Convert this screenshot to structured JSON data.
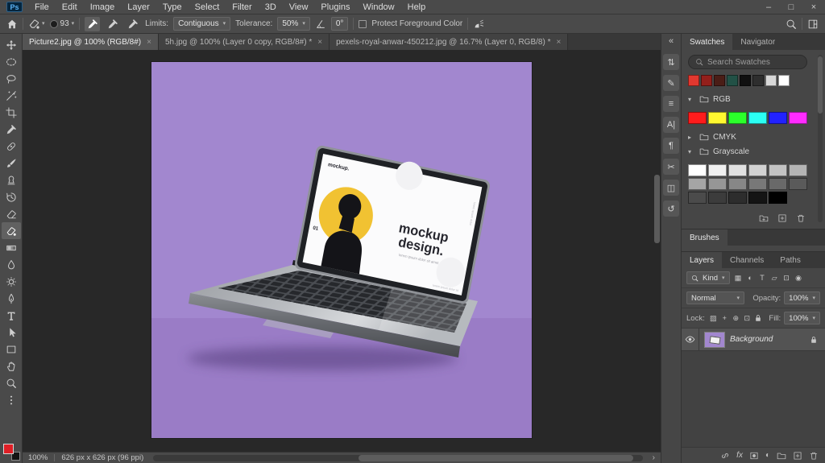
{
  "window": {
    "controls": {
      "minimize": "–",
      "maximize": "□",
      "close": "×"
    }
  },
  "ui": {
    "close_glyph": "×",
    "caret": "▾",
    "chevron_expanded": "▾",
    "chevron_collapsed": "▸",
    "status_chevron": "›",
    "collapse_glyph": "«"
  },
  "menu_bar": {
    "logo": "Ps",
    "items": [
      "File",
      "Edit",
      "Image",
      "Layer",
      "Type",
      "Select",
      "Filter",
      "3D",
      "View",
      "Plugins",
      "Window",
      "Help"
    ]
  },
  "options_bar": {
    "brush_size": "93",
    "limits_label": "Limits:",
    "limits_value": "Contiguous",
    "tolerance_label": "Tolerance:",
    "tolerance_value": "50%",
    "angle_value": "0°",
    "protect_label": "Protect Foreground Color"
  },
  "document_tabs": [
    {
      "label": "Picture2.jpg @ 100% (RGB/8#)",
      "active": true
    },
    {
      "label": "5h.jpg @ 100% (Layer 0 copy, RGB/8#) *",
      "active": false
    },
    {
      "label": "pexels-royal-anwar-450212.jpg @ 16.7% (Layer 0, RGB/8) *",
      "active": false
    }
  ],
  "toolbar": {
    "foreground_color": "#e01f26",
    "background_color": "#141414",
    "tools": [
      {
        "name": "move"
      },
      {
        "name": "marquee"
      },
      {
        "name": "lasso"
      },
      {
        "name": "quick-selection"
      },
      {
        "name": "crop"
      },
      {
        "name": "eyedropper"
      },
      {
        "name": "healing-brush"
      },
      {
        "name": "brush"
      },
      {
        "name": "clone-stamp"
      },
      {
        "name": "history-brush"
      },
      {
        "name": "eraser"
      },
      {
        "name": "background-eraser",
        "selected": true
      },
      {
        "name": "gradient"
      },
      {
        "name": "blur"
      },
      {
        "name": "dodge"
      },
      {
        "name": "pen"
      },
      {
        "name": "type"
      },
      {
        "name": "path-selection"
      },
      {
        "name": "rectangle"
      },
      {
        "name": "hand"
      },
      {
        "name": "zoom"
      },
      {
        "name": "edit-toolbar"
      }
    ]
  },
  "canvas": {
    "artwork": {
      "background_top": "#a287cf",
      "background_floor": "#9a7cc6",
      "accent_circle_color": "#f1c232",
      "laptop_screen": {
        "brand": "mockup.",
        "title_line1": "mockup",
        "title_line2": "design.",
        "subtitle": "lorem ipsum dolor sit amet",
        "index": "01",
        "side_text": "lorem ipsum dolor",
        "footer_text": "lorem ipsum dolor sit"
      }
    }
  },
  "status_bar": {
    "zoom": "100%",
    "dimensions": "626 px x 626 px (96 ppi)"
  },
  "panels": {
    "icon_strip": [
      {
        "name": "collapse-panels",
        "glyph": "«"
      },
      {
        "name": "arrows-panel",
        "glyph": "⇅"
      },
      {
        "name": "pen-panel",
        "glyph": "✎"
      },
      {
        "name": "adjustments-panel",
        "glyph": "≡"
      },
      {
        "name": "character-panel",
        "glyph": "A|"
      },
      {
        "name": "paragraph-panel",
        "glyph": "¶"
      },
      {
        "name": "scissors-panel",
        "glyph": "✂"
      },
      {
        "name": "cube-panel",
        "glyph": "◫"
      },
      {
        "name": "history-panel",
        "glyph": "↺"
      }
    ],
    "swatches": {
      "tabs": [
        {
          "label": "Swatches",
          "active": true
        },
        {
          "label": "Navigator",
          "active": false
        }
      ],
      "search_placeholder": "Search Swatches",
      "recent_swatches": [
        "#e2382f",
        "#931f1b",
        "#4a1d16",
        "#225146",
        "#101010",
        "#2e2e2e",
        "#d8d8d8",
        "#ffffff"
      ],
      "groups": [
        {
          "name": "RGB",
          "expanded": true,
          "swatches": [
            "#ff1c1c",
            "#fff830",
            "#2bff2b",
            "#2bfff3",
            "#2222ff",
            "#ff2bff"
          ]
        },
        {
          "name": "CMYK",
          "expanded": false,
          "swatches": []
        },
        {
          "name": "Grayscale",
          "expanded": true,
          "swatches": [
            "#ffffff",
            "#f0f0f0",
            "#e1e1e1",
            "#d2d2d2",
            "#c3c3c3",
            "#b4b4b4",
            "#a5a5a5",
            "#969696",
            "#878787",
            "#787878",
            "#696969",
            "#5a5a5a",
            "#4b4b4b",
            "#3c3c3c",
            "#2d2d2d",
            "#141414",
            "#000000"
          ]
        }
      ],
      "footer_icons": [
        {
          "name": "new-swatch-group",
          "icon": "svg:folder-plus"
        },
        {
          "name": "new-swatch",
          "icon": "svg:plus-square"
        },
        {
          "name": "delete-swatch",
          "icon": "svg:trash"
        }
      ]
    },
    "brushes_tab": "Brushes",
    "layers": {
      "tabs": [
        {
          "label": "Layers",
          "active": true
        },
        {
          "label": "Channels",
          "active": false
        },
        {
          "label": "Paths",
          "active": false
        }
      ],
      "kind_label": "Kind",
      "filter_icons": [
        {
          "name": "filter-pixel-layers",
          "glyph": "▦"
        },
        {
          "name": "filter-adjustment-layers",
          "glyph": "◐"
        },
        {
          "name": "filter-type-layers",
          "glyph": "T"
        },
        {
          "name": "filter-shape-layers",
          "glyph": "▱"
        },
        {
          "name": "filter-smart-objects",
          "glyph": "⊡"
        },
        {
          "name": "filter-toggle",
          "glyph": "◉"
        }
      ],
      "blend_mode": "Normal",
      "opacity_label": "Opacity:",
      "opacity_value": "100%",
      "lock_label": "Lock:",
      "lock_icons": [
        {
          "name": "lock-transparency",
          "glyph": "▨"
        },
        {
          "name": "lock-pixels",
          "glyph": "+"
        },
        {
          "name": "lock-position",
          "glyph": "⊕"
        },
        {
          "name": "lock-artboard",
          "glyph": "⊡"
        },
        {
          "name": "lock-all",
          "glyph": "svg:lock"
        }
      ],
      "fill_label": "Fill:",
      "fill_value": "100%",
      "layers": [
        {
          "name": "Background",
          "visible": true,
          "locked": true,
          "selected": true
        }
      ],
      "footer_icons": [
        {
          "name": "link-layers",
          "icon": "svg:link"
        },
        {
          "name": "layer-effects",
          "icon": "txt:fx"
        },
        {
          "name": "add-layer-mask",
          "icon": "svg:mask"
        },
        {
          "name": "adjustment-layer",
          "icon": "txt:◐"
        },
        {
          "name": "new-group",
          "icon": "svg:folder"
        },
        {
          "name": "new-layer",
          "icon": "svg:plus-square"
        },
        {
          "name": "delete-layer",
          "icon": "svg:trash"
        }
      ]
    }
  }
}
